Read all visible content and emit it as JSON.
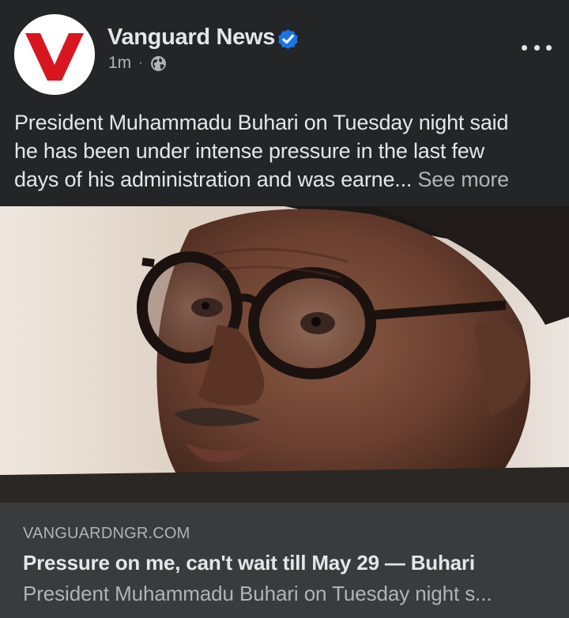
{
  "post": {
    "page_name": "Vanguard News",
    "timestamp": "1m",
    "separator": "·",
    "audience_icon": "globe-icon",
    "verified_icon": "verified-badge-icon",
    "more_icon": "more-options-icon",
    "avatar_logo_letter": "V",
    "text_lines": [
      "President Muhammadu Buhari on Tuesday night said",
      "he has been under intense pressure in the last few",
      "days of his administration and was earne..."
    ],
    "see_more": "See more"
  },
  "link_preview": {
    "domain": "VANGUARDNGR.COM",
    "title": "Pressure on me, can't wait till May 29 — Buhari",
    "description": "President Muhammadu Buhari on Tuesday night s..."
  },
  "colors": {
    "background": "#242526",
    "card": "#3a3b3c",
    "primary_text": "#e4e6eb",
    "secondary_text": "#b0b3b8",
    "verified_blue": "#1b74e4",
    "logo_red": "#d7161f"
  }
}
